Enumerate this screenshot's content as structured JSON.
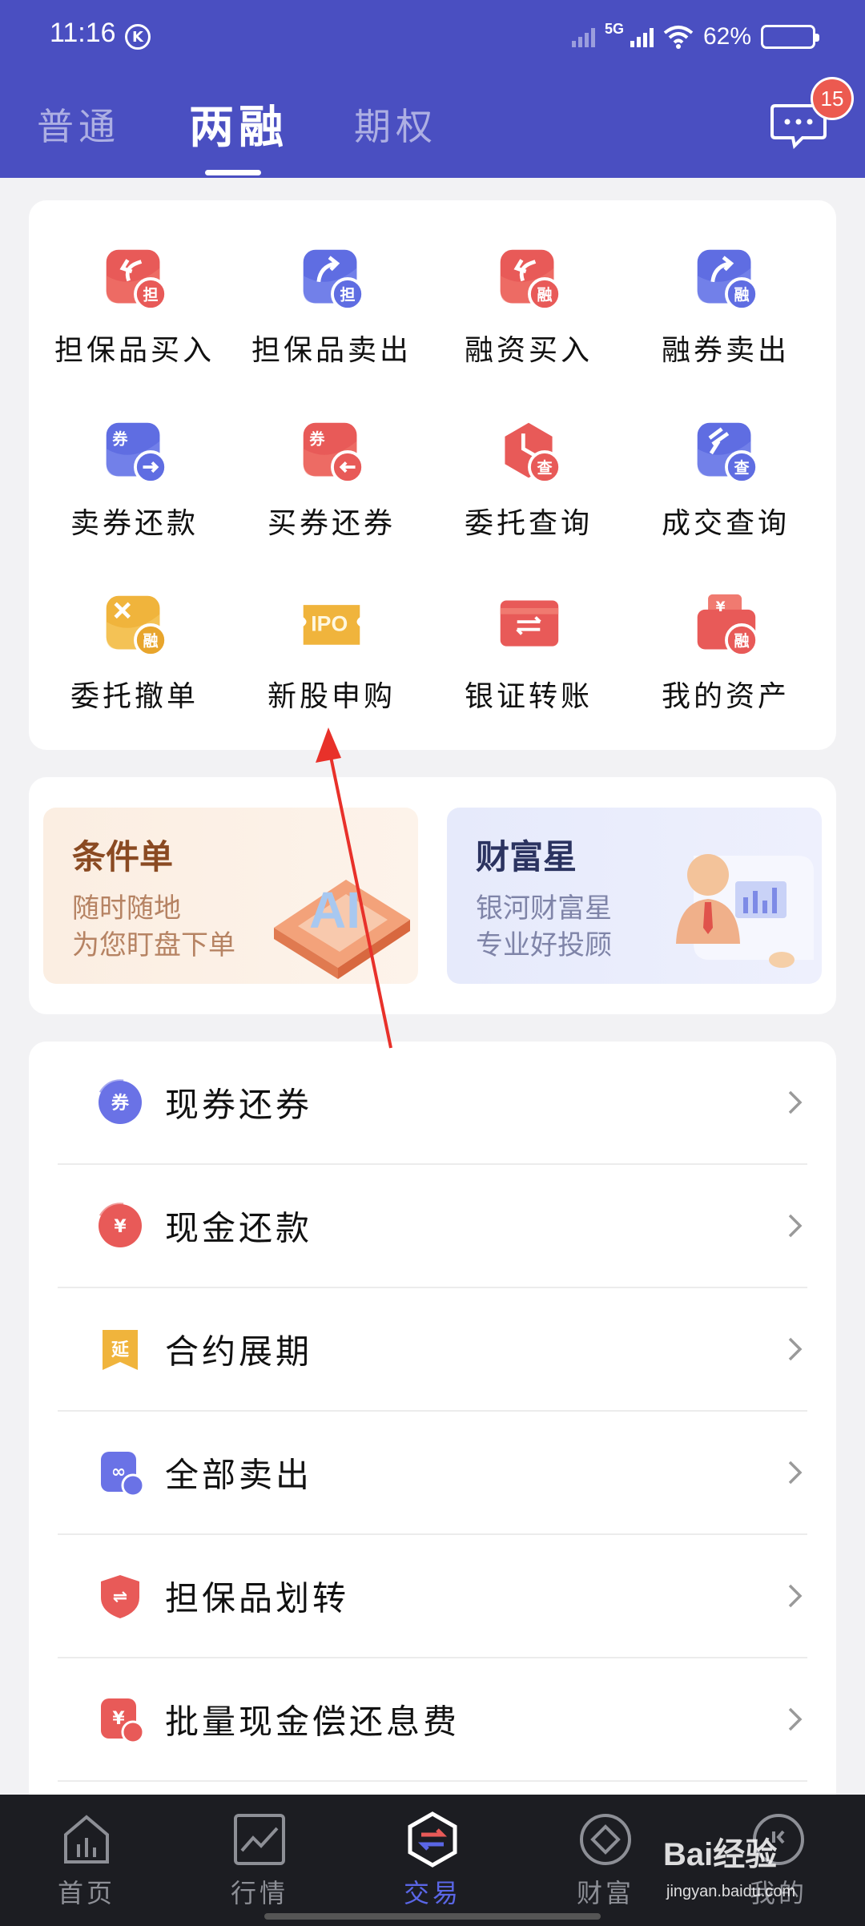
{
  "status_bar": {
    "time": "11:16",
    "k_badge": "K",
    "network": "5G",
    "battery": "62%",
    "battery_level": 0.62
  },
  "tabs": [
    {
      "label": "普通",
      "active": false
    },
    {
      "label": "两融",
      "active": true
    },
    {
      "label": "期权",
      "active": false
    }
  ],
  "message_badge": "15",
  "grid": [
    {
      "label": "担保品买入",
      "icon": "return-arrow-icon",
      "badge": "担",
      "color": "#e85a58"
    },
    {
      "label": "担保品卖出",
      "icon": "forward-arrow-icon",
      "badge": "担",
      "color": "#5f6de2"
    },
    {
      "label": "融资买入",
      "icon": "return-arrow-icon",
      "badge": "融",
      "color": "#e85a58"
    },
    {
      "label": "融券卖出",
      "icon": "forward-arrow-icon",
      "badge": "融",
      "color": "#5f6de2"
    },
    {
      "label": "卖券还款",
      "icon": "coupon-arrow-right-icon",
      "badge": "券",
      "color": "#5f6de2"
    },
    {
      "label": "买券还券",
      "icon": "coupon-arrow-left-icon",
      "badge": "券",
      "color": "#e85a58"
    },
    {
      "label": "委托查询",
      "icon": "clock-query-icon",
      "badge": "查",
      "color": "#e85a58"
    },
    {
      "label": "成交查询",
      "icon": "gavel-query-icon",
      "badge": "查",
      "color": "#5f6de2"
    },
    {
      "label": "委托撤单",
      "icon": "cancel-order-icon",
      "badge": "融",
      "color": "#f0b43c"
    },
    {
      "label": "新股申购",
      "icon": "ipo-ticket-icon",
      "badge": "IPO",
      "color": "#f0b43c"
    },
    {
      "label": "银证转账",
      "icon": "bank-transfer-icon",
      "badge": "⇌",
      "color": "#e85a58"
    },
    {
      "label": "我的资产",
      "icon": "wallet-icon",
      "badge": "融",
      "color": "#e85a58"
    }
  ],
  "banners": [
    {
      "title": "条件单",
      "line1": "随时随地",
      "line2": "为您盯盘下单",
      "art": "AI"
    },
    {
      "title": "财富星",
      "line1": "银河财富星",
      "line2": "专业好投顾"
    }
  ],
  "list": [
    {
      "label": "现券还券",
      "icon": "coupon-circle-icon",
      "glyph": "券",
      "color": "#6a72e6"
    },
    {
      "label": "现金还款",
      "icon": "yuan-circle-icon",
      "glyph": "¥",
      "color": "#e85a58"
    },
    {
      "label": "合约展期",
      "icon": "extend-bookmark-icon",
      "glyph": "延",
      "color": "#f0b43c"
    },
    {
      "label": "全部卖出",
      "icon": "sell-all-icon",
      "glyph": "∞",
      "color": "#6a72e6"
    },
    {
      "label": "担保品划转",
      "icon": "shield-transfer-icon",
      "glyph": "⇌",
      "color": "#e85a58"
    },
    {
      "label": "批量现金偿还息费",
      "icon": "batch-repay-icon",
      "glyph": "¥",
      "color": "#e85a58"
    }
  ],
  "bottom_nav": [
    {
      "label": "首页",
      "icon": "home-chart-icon",
      "active": false
    },
    {
      "label": "行情",
      "icon": "market-trend-icon",
      "active": false
    },
    {
      "label": "交易",
      "icon": "trade-exchange-icon",
      "active": true
    },
    {
      "label": "财富",
      "icon": "wealth-diamond-icon",
      "active": false
    },
    {
      "label": "我的",
      "icon": "profile-icon",
      "active": false
    }
  ],
  "watermark": {
    "text": "Bai经验",
    "sub": "jingyan.baidu.com"
  },
  "colors": {
    "header": "#4a4fc1",
    "accent": "#5a66e6",
    "red": "#e85a58",
    "blue": "#5f6de2",
    "gold": "#f0b43c"
  }
}
